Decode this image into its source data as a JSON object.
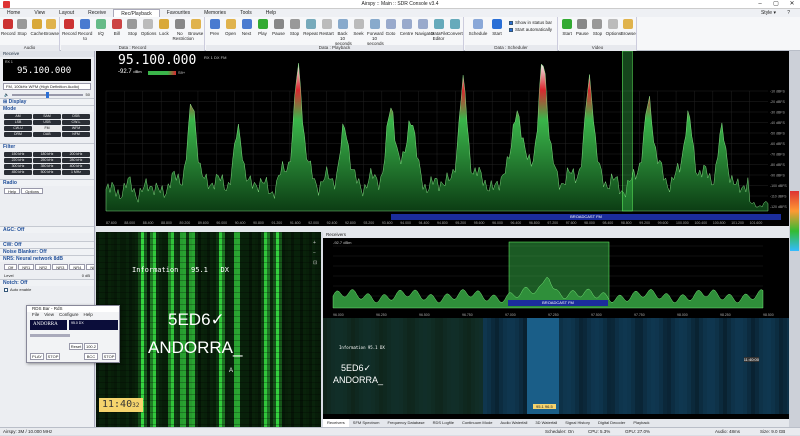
{
  "window": {
    "title": "Airspy :: Main :: SDR Console v3.4",
    "help_label": "?",
    "style_label": "Style"
  },
  "menu": [
    "Home",
    "View",
    "Layout",
    "Receive",
    "Rec/Playback",
    "Favourites",
    "Memories",
    "Tools",
    "Help"
  ],
  "menu_active": "Rec/Playback",
  "ribbon": {
    "audio": {
      "label": "Audio",
      "buttons": [
        "Record",
        "Stop",
        "Cache",
        "Browse"
      ]
    },
    "data_record": {
      "label": "Data : Record",
      "buttons": [
        "Record",
        "Record to",
        "I/Q",
        "Bill",
        "Stop",
        "Options",
        "Lock",
        "No Restriction",
        "Browse"
      ]
    },
    "data_playback": {
      "label": "Data : Playback",
      "buttons": [
        "Prev",
        "Open",
        "Next",
        "Play",
        "Pause",
        "Stop",
        "Repeat",
        "Restart",
        "Back 10 seconds",
        "Seek",
        "Forward 10 seconds",
        "Goto",
        "Centre",
        "Navigator",
        "DataFile Editor",
        "Convert"
      ]
    },
    "data_scheduler": {
      "label": "Data : Scheduler",
      "buttons": [
        "Schedule",
        "Start"
      ],
      "checks": [
        {
          "label": "Show in status bar",
          "on": true
        },
        {
          "label": "Start automatically",
          "on": true
        }
      ]
    },
    "video": {
      "label": "Video",
      "buttons": [
        "Start",
        "Pause",
        "Stop",
        "Options",
        "Browse"
      ]
    }
  },
  "left_panel": {
    "receive_title": "Receive",
    "rx_label": "RX 1",
    "frequency": "95.100.000",
    "status": "DX",
    "mode_select": "FM, 100kHz WFM (High Definition Audio)",
    "volume": "50",
    "sections": {
      "display": "Display",
      "mode": "Mode",
      "filter": "Filter",
      "radio": "Radio",
      "agc": "AGC: Off",
      "cw": "CW: Off",
      "noise_blanker": "Noise Blanker: Off",
      "nr": "NR5: Neural network 8dB",
      "notch": "Notch: Off",
      "level": "Level",
      "level_value": "0 dB",
      "auto_enable": "Auto enable"
    },
    "mode_buttons": [
      "AM",
      "SAM",
      "DSB",
      "LSB",
      "USB",
      "CW-L",
      "CW-U",
      "FM",
      "WFM",
      "DRM",
      "DAB",
      "NFM"
    ],
    "mode_selected": "FM",
    "filter_buttons": [
      "150 kHz",
      "180 kHz",
      "200 kHz",
      "220 kHz",
      "250 kHz",
      "280 kHz",
      "300 kHz",
      "350 kHz",
      "400 kHz",
      "450 kHz",
      "500 kHz",
      "1 MHz"
    ],
    "radio_tabs": [
      "Help",
      "Options"
    ],
    "nr_buttons": [
      "Off",
      "NR1",
      "NR2",
      "NR3",
      "NR4",
      "NR5"
    ],
    "bottom_status": "Airspy: 3M / 10.000 MHz"
  },
  "spectrum": {
    "frequency": "95.100.000",
    "rx_info": "RX 1  DX  FM",
    "level": "-92.7",
    "level_unit": "dBm",
    "smeter_label": "S9+",
    "band_label": "BROADCAST FM",
    "db_scale": [
      "-10 dBFS",
      "-20 dBFS",
      "-30 dBFS",
      "-40 dBFS",
      "-50 dBFS",
      "-60 dBFS",
      "-70 dBFS",
      "-80 dBFS",
      "-90 dBFS",
      "-100 dBFS",
      "-110 dBFS",
      "-120 dBFS"
    ],
    "freq_scale": [
      "87.600",
      "88.000",
      "88.400",
      "88.800",
      "89.200",
      "89.600",
      "90.000",
      "90.400",
      "90.800",
      "91.200",
      "91.600",
      "92.000",
      "92.400",
      "92.800",
      "93.200",
      "93.600",
      "94.000",
      "94.400",
      "94.800",
      "95.200",
      "95.600",
      "96.000",
      "96.400",
      "96.800",
      "97.200",
      "97.600",
      "98.000",
      "98.400",
      "98.800",
      "99.200",
      "99.600",
      "100.000",
      "100.400",
      "100.800",
      "101.200",
      "101.600"
    ]
  },
  "waterfall": {
    "info_line": "Information",
    "info_freq": "95.1",
    "info_dx": "DX",
    "callsign": "5ED6✓",
    "station": "ANDORRA_",
    "marker": "A",
    "clock": "11:40",
    "clock_sec": "32"
  },
  "receivers": {
    "title": "Receivers",
    "rx_line": "-92.7 dBm",
    "band_label": "BROADCAST FM",
    "info_line": "Information  95.1  DX",
    "callsign": "5ED6✓",
    "station": "ANDORRA_",
    "time_marker": "11:40:00",
    "small_label": "95.1  96.5",
    "tabs": [
      "Receivers",
      "SFM Spectrum",
      "Frequency Database",
      "RDS Logfile",
      "Continuum Mode",
      "Audio Waterfall",
      "3D Waterfall",
      "Signal History",
      "Digital Decoder",
      "Playback"
    ],
    "freq_scale": [
      "96.000",
      "96.250",
      "96.500",
      "96.750",
      "97.000",
      "97.250",
      "97.500",
      "97.750",
      "98.000",
      "98.250",
      "98.500"
    ]
  },
  "floating_window": {
    "title": "RDS Bar - RdS",
    "menu": [
      "File",
      "View",
      "Configure",
      "Help"
    ],
    "station": "ANDORRA",
    "pi": "95.0",
    "pty": "DX",
    "buttons": [
      "PLAY",
      "STOP",
      "Reset",
      "BCC",
      "STOP"
    ],
    "slider_value": "100.2"
  },
  "statusbar": {
    "device": "Airspy: 3M / 10.000 MHz",
    "scheduler": "Scheduler: On",
    "cpu": "CPU: 5.3%",
    "gpu": "GPU: 27.0%",
    "audio": "Audio: 48ms",
    "size": "Size: 9.0 GB"
  },
  "colors": {
    "spectrum_bg": "#000000",
    "trace_green": "#3ab54a",
    "peak_red": "#d9282f",
    "band_blue": "#1b2d9c",
    "accent": "#2a6fd6"
  }
}
